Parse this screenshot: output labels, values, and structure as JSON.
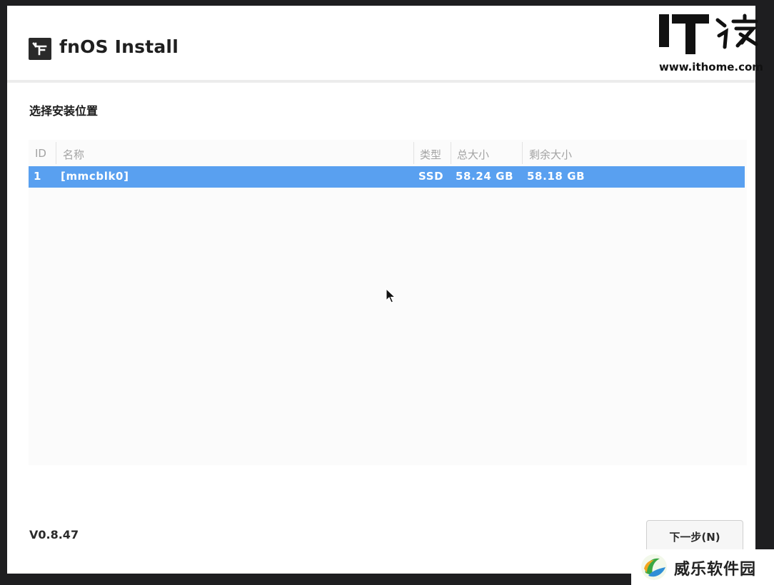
{
  "app": {
    "title": "fnOS Install",
    "logo_icon": "fnos-logo-icon"
  },
  "page": {
    "section_title": "选择安装位置"
  },
  "disk_table": {
    "columns": [
      "ID",
      "名称",
      "类型",
      "总大小",
      "剩余大小"
    ],
    "rows": [
      {
        "id": "1",
        "name": "[mmcblk0]",
        "type": "SSD",
        "total": "58.24 GB",
        "free": "58.18 GB",
        "selected": true
      }
    ]
  },
  "footer": {
    "version": "V0.8.47",
    "next_button_label": "下一步(N)"
  },
  "watermarks": {
    "site_url": "www.ithome.com",
    "site_logo": "IT之家",
    "bottom_badge_text": "威乐软件园"
  },
  "colors": {
    "selection": "#59a0f0",
    "background": "#1e1e20"
  }
}
